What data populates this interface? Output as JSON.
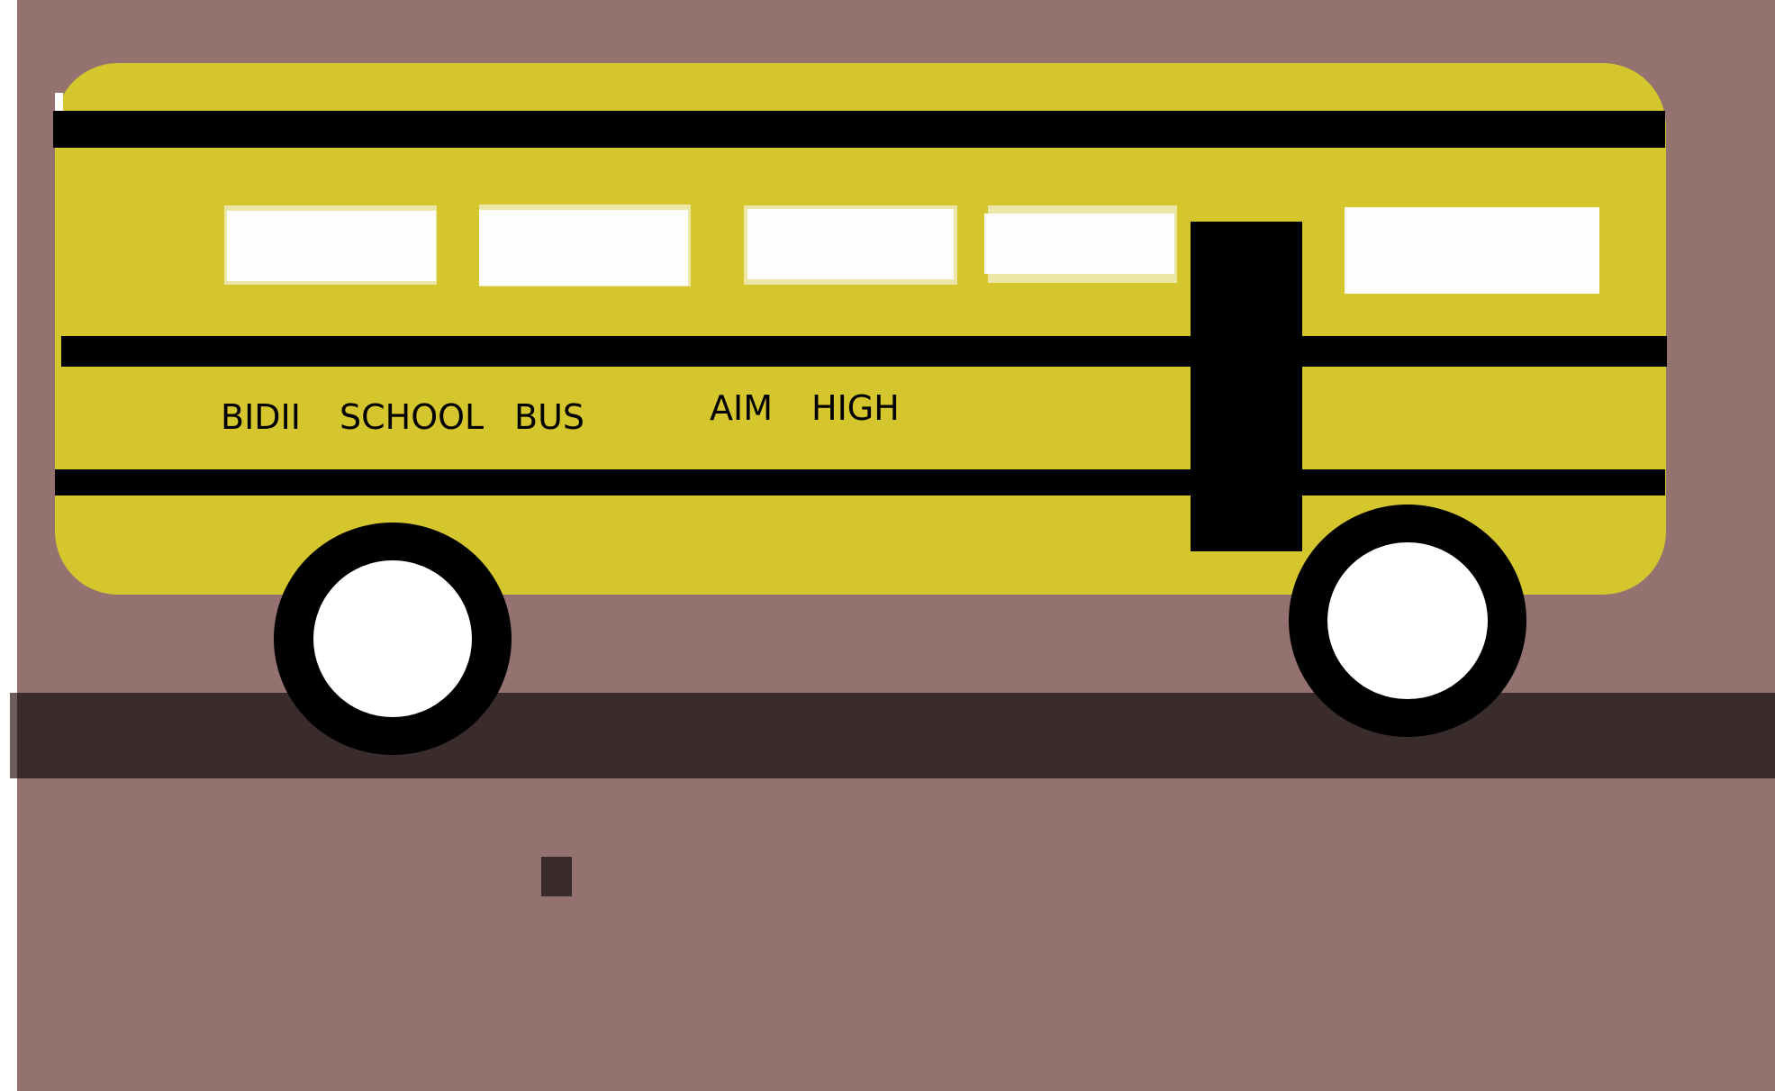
{
  "colors": {
    "page": "#ffffff",
    "background": "#93726f",
    "bus_body": "#d5c62d",
    "stripe": "#000000",
    "window": "#fdfefb",
    "window_outline": "#ece6a7",
    "door": "#000000",
    "road": "#3a2c2d",
    "tire": "#000000",
    "hub": "#ffffff",
    "marker": "#3a2c2d"
  },
  "bus": {
    "text_name_parts": [
      "BIDII",
      "SCHOOL",
      "BUS"
    ],
    "text_motto_parts": [
      "AIM",
      "HIGH"
    ]
  }
}
